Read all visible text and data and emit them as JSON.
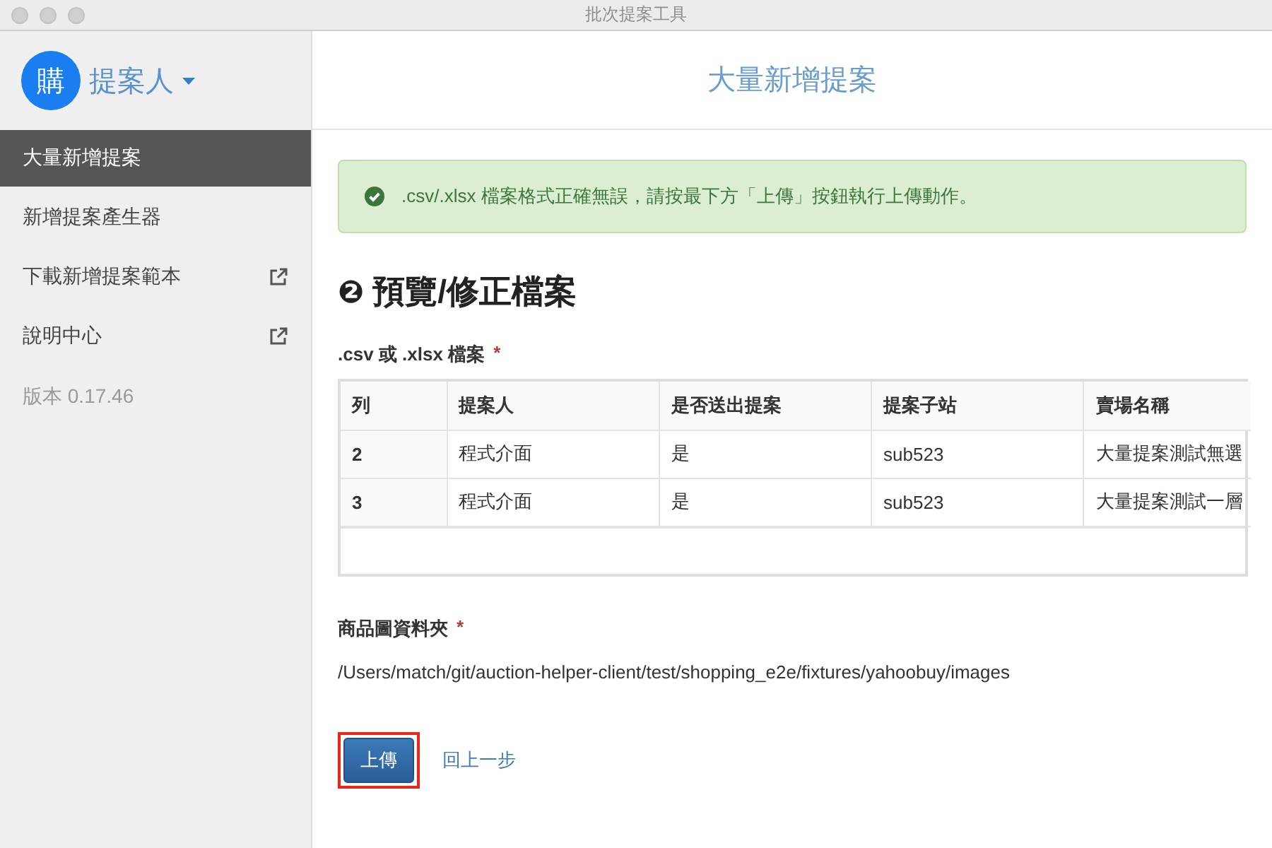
{
  "window": {
    "title": "批次提案工具"
  },
  "sidebar": {
    "avatar": "購",
    "user": "提案人",
    "items": [
      {
        "label": "大量新增提案",
        "selected": true,
        "external": false
      },
      {
        "label": "新增提案產生器",
        "selected": false,
        "external": false
      },
      {
        "label": "下載新增提案範本",
        "selected": false,
        "external": true
      },
      {
        "label": "說明中心",
        "selected": false,
        "external": true
      }
    ],
    "version": "版本 0.17.46"
  },
  "header": {
    "title": "大量新增提案"
  },
  "alert": {
    "kind": "success",
    "text": ".csv/.xlsx 檔案格式正確無誤，請按最下方「上傳」按鈕執行上傳動作。"
  },
  "section": {
    "step": "❷",
    "title": "預覽/修正檔案"
  },
  "file_field": {
    "label": ".csv 或 .xlsx 檔案",
    "required_mark": "*"
  },
  "table": {
    "columns": [
      "列",
      "提案人",
      "是否送出提案",
      "提案子站",
      "賣場名稱"
    ],
    "rows": [
      [
        "2",
        "程式介面",
        "是",
        "sub523",
        "大量提案測試無選"
      ],
      [
        "3",
        "程式介面",
        "是",
        "sub523",
        "大量提案測試一層"
      ]
    ]
  },
  "folder_field": {
    "label": "商品圖資料夾",
    "required_mark": "*",
    "value": "/Users/match/git/auction-helper-client/test/shopping_e2e/fixtures/yahoobuy/images"
  },
  "actions": {
    "upload": {
      "label": "上傳",
      "highlighted": true
    },
    "back": "回上一步"
  }
}
